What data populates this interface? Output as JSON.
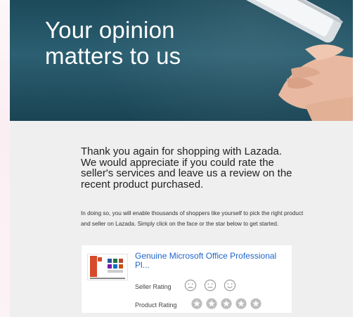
{
  "hero": {
    "title_line1": "Your opinion",
    "title_line2": "matters to us"
  },
  "message": {
    "intro": "Thank you again for shopping with Lazada. We would appreciate if you could rate the seller's services and leave us a review on the recent product purchased.",
    "details": "In doing so, you will enable thousands of shoppers like yourself to pick the right product and seller on Lazada. Simply click on the face or the star below to get started."
  },
  "product": {
    "title": "Genuine Microsoft Office Professional Pl...",
    "thumbnail_icon": "office-box-icon"
  },
  "ratings": {
    "seller_label": "Seller Rating",
    "product_label": "Product Rating",
    "faces": [
      "sad-face-icon",
      "neutral-face-icon",
      "happy-face-icon"
    ],
    "stars": [
      "star-icon",
      "star-icon",
      "star-icon",
      "star-icon",
      "star-icon"
    ]
  },
  "colors": {
    "hero_bg": "#245566",
    "content_bg": "#efefef",
    "link": "#1f65c9",
    "star": "#bdbdbd"
  }
}
